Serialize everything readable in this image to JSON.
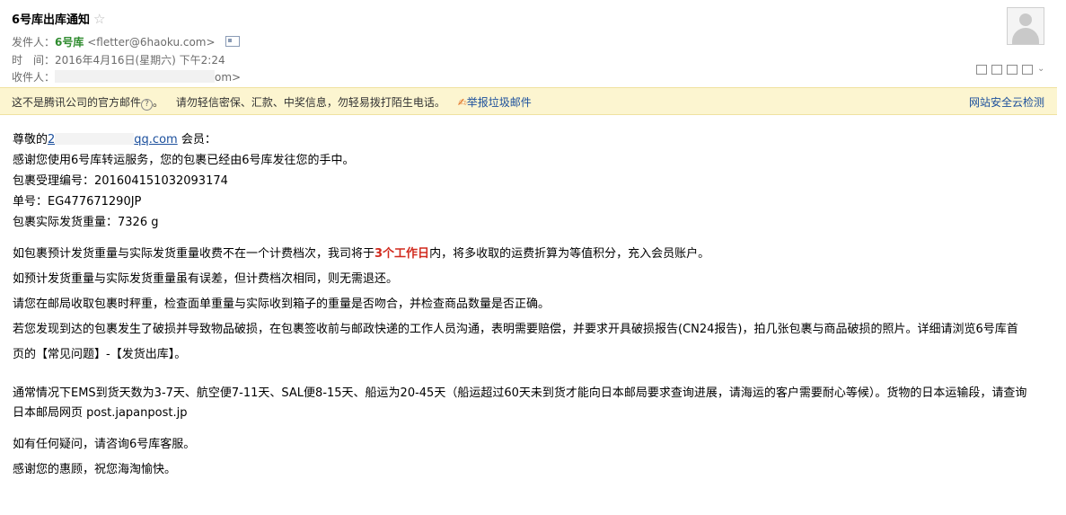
{
  "header": {
    "subject": "6号库出库通知",
    "star_glyph": "☆",
    "sender_label": "发件人：",
    "sender_name": "6号库",
    "sender_email": "<fletter@6haoku.com>",
    "time_label": "时　间：",
    "time_value": "2016年4月16日(星期六) 下午2:24",
    "recipient_label": "收件人：",
    "recipient_tail": "om>"
  },
  "warning_bar": {
    "notice": "这不是腾讯公司的官方邮件",
    "advice": "请勿轻信密保、汇款、中奖信息，勿轻易拨打陌生电话。",
    "report_label": "举报垃圾邮件",
    "cloud_check_label": "网站安全云检测"
  },
  "body": {
    "greeting_prefix": "尊敬的",
    "greeting_email_start": "2",
    "greeting_email_end": "qq.com",
    "greeting_suffix": "会员：",
    "thanks": "感谢您使用6号库转运服务，您的包裹已经由6号库发往您的手中。",
    "tracking_id_line": "包裹受理编号：201604151032093174",
    "waybill_line": "单号：EG477671290JP",
    "weight_line": "包裹实际发货重量：7326 g",
    "refund_p1": "如包裹预计发货重量与实际发货重量收费不在一个计费档次，我司将于",
    "refund_highlight": "3个工作日",
    "refund_p2": "内，将多收取的运费折算为等值积分，充入会员账户。",
    "no_refund": "如预计发货重量与实际发货重量虽有误差，但计费档次相同，则无需退还。",
    "check_advice": "请您在邮局收取包裹时秤重，检查面单重量与实际收到箱子的重量是否吻合，并检查商品数量是否正确。",
    "damage_advice": "若您发现到达的包裹发生了破损并导致物品破损，在包裹签收前与邮政快递的工作人员沟通，表明需要赔偿，并要求开具破损报告(CN24报告)，拍几张包裹与商品破损的照片。详细请浏览6号库首页的【常见问题】-【发货出库】。",
    "shipping_times": "通常情况下EMS到货天数为3-7天、航空便7-11天、SAL便8-15天、船运为20-45天（船运超过60天未到货才能向日本邮局要求查询进展，请海运的客户需要耐心等候）。货物的日本运输段，请查询日本邮局网页 post.japanpost.jp",
    "contact": "如有任何疑问，请咨询6号库客服。",
    "closing": "感谢您的惠顾，祝您海淘愉快。"
  },
  "colors": {
    "sender_name": "#2e8b2e",
    "warning_background": "#fcf5d0",
    "link": "#1b4f9c",
    "highlight": "#d12a1e"
  },
  "icons": [
    "star-icon",
    "contact-card-icon",
    "avatar-placeholder",
    "new-window-icon",
    "popout-icon",
    "export-icon",
    "print-icon",
    "more-chevron-icon",
    "question-icon",
    "report-icon"
  ]
}
